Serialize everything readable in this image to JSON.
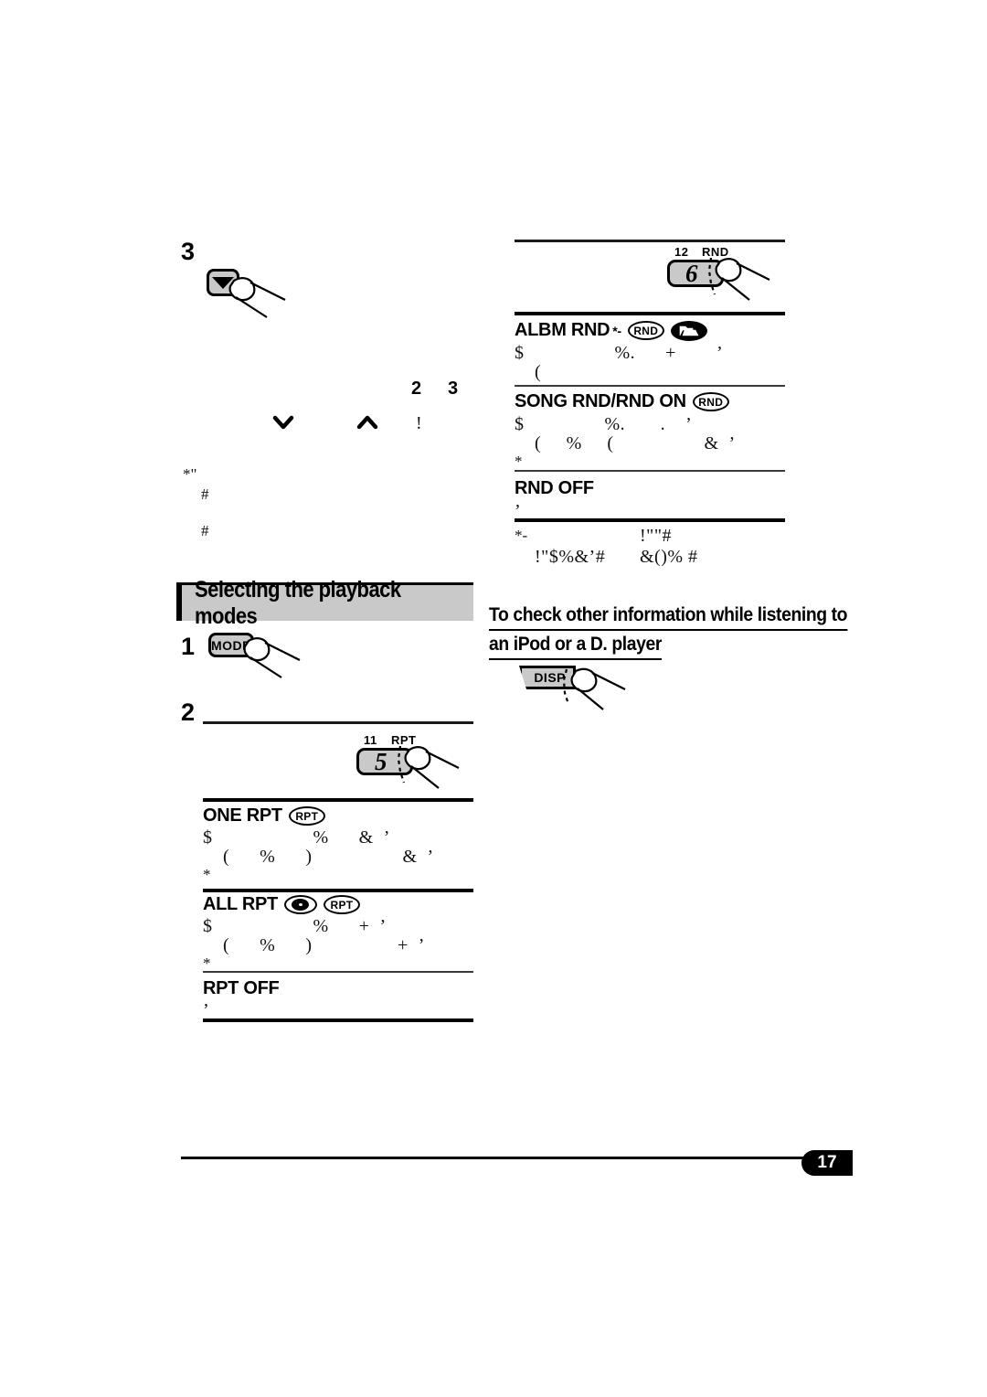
{
  "page": {
    "number": "17",
    "document_type": "car-audio-receiver-manual"
  },
  "left_column": {
    "step3": {
      "number": "3",
      "button_icon": "down-arrow-button",
      "note_line_a": "2",
      "note_line_b": "3",
      "chevron_down": "⌄",
      "chevron_up": "⌃",
      "inline_mark": "!",
      "footnote_marker": "*\"",
      "bullets": [
        "#",
        "#"
      ]
    },
    "section": {
      "title": "Selecting the playback modes",
      "step1": {
        "number": "1",
        "button_label": "MODE"
      },
      "step2": {
        "number": "2",
        "display_preset": "11",
        "display_indicator": "RPT",
        "display_number": "5"
      },
      "modes": [
        {
          "name": "ONE RPT",
          "badges": [
            "rpt-oval"
          ],
          "lines": [
            "$                    %      &  ’",
            "    (      %      )                  &  ’",
            "*"
          ]
        },
        {
          "name": "ALL RPT",
          "badges": [
            "disc-oval",
            "rpt-oval"
          ],
          "lines": [
            "$                    %      +  ’",
            "    (      %      )                 +  ’",
            "*"
          ]
        },
        {
          "name": "RPT OFF",
          "badges": [],
          "lines": [
            "’"
          ]
        }
      ]
    }
  },
  "right_column": {
    "top_display": {
      "display_preset": "12",
      "display_indicator": "RND",
      "display_number": "6"
    },
    "modes": [
      {
        "name": "ALBM RND",
        "superscript": "*-",
        "badges": [
          "rnd-oval",
          "folder-oval"
        ],
        "lines": [
          "$                  %.      +        ’",
          "    ("
        ]
      },
      {
        "name": "SONG RND/RND ON",
        "superscript": "",
        "badges": [
          "rnd-oval"
        ],
        "lines": [
          "$                %.       .    ’",
          "    (     %     (                  &  ’",
          "*"
        ]
      },
      {
        "name": "RND OFF",
        "superscript": "",
        "badges": [],
        "lines": [
          "’"
        ]
      }
    ],
    "footnote": {
      "marker": "*-",
      "line1_right": "!\"\"#",
      "line2_left": "!\"$%&’#",
      "line2_right": "&()% #"
    },
    "sub_heading": {
      "line1": "To check other information while listening to",
      "line2": "an iPod or a D. player",
      "button_label": "DISP"
    }
  },
  "colors": {
    "button_face": "#c9c9c9",
    "section_bar": "#c9c9c9",
    "ink": "#000000",
    "page_background": "#ffffff"
  }
}
